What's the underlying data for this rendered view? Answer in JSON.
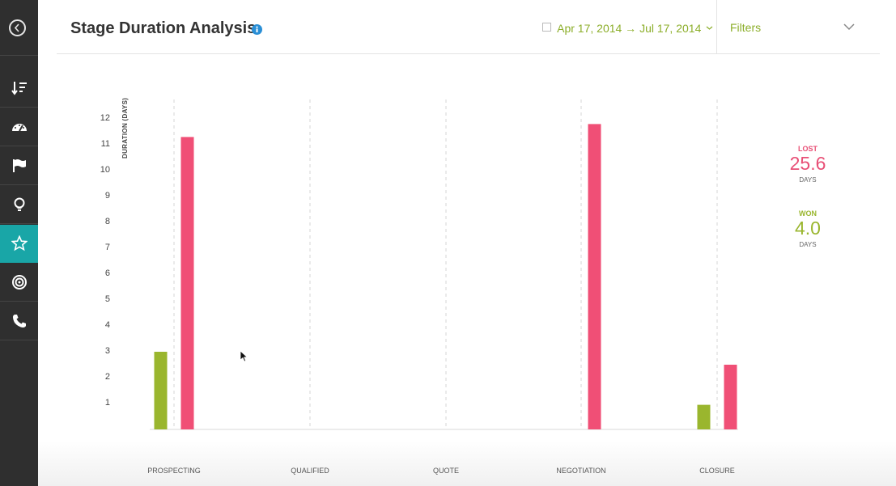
{
  "header": {
    "title": "Stage Duration Analysis",
    "date_range": "Apr 17, 2014 → Jul 17, 2014",
    "filters_label": "Filters"
  },
  "sidebar": {
    "items": [
      {
        "icon": "sort-icon"
      },
      {
        "icon": "dashboard-gauge-icon"
      },
      {
        "icon": "flag-icon"
      },
      {
        "icon": "lightbulb-icon"
      },
      {
        "icon": "star-icon",
        "active": true
      },
      {
        "icon": "target-icon"
      },
      {
        "icon": "phone-icon"
      }
    ],
    "active_color": "#19a6a7"
  },
  "summary": {
    "lost": {
      "label": "LOST",
      "value": "25.6",
      "unit": "DAYS",
      "color": "#e84f76"
    },
    "won": {
      "label": "WON",
      "value": "4.0",
      "unit": "DAYS",
      "color": "#9ab62e"
    }
  },
  "chart_data": {
    "type": "bar",
    "ylabel": "DURATION (DAYS)",
    "ylim": [
      0,
      12
    ],
    "yticks": [
      1,
      2,
      3,
      4,
      5,
      6,
      7,
      8,
      9,
      10,
      11,
      12
    ],
    "categories": [
      "PROSPECTING",
      "QUALIFIED",
      "QUOTE",
      "NEGOTIATION",
      "CLOSURE"
    ],
    "series": [
      {
        "name": "WON",
        "color": "#9ab62e",
        "values": [
          3.0,
          0,
          0,
          0,
          0.95
        ]
      },
      {
        "name": "LOST",
        "color": "#f04f76",
        "values": [
          11.3,
          0,
          0,
          11.8,
          2.5
        ]
      }
    ],
    "grid": "vertical-dashed"
  }
}
